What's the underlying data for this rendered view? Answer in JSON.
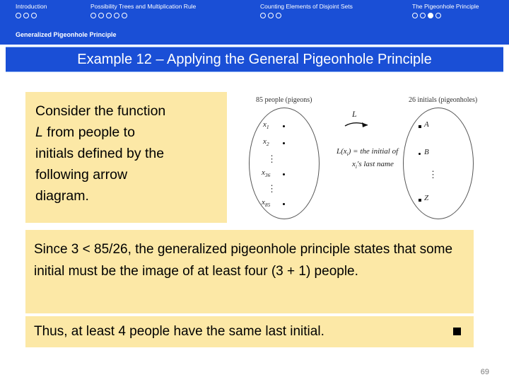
{
  "nav": {
    "sections": [
      {
        "label": "Introduction",
        "dots_total": 3,
        "dots_filled": 0
      },
      {
        "label": "Possibility Trees and Multiplication Rule",
        "dots_total": 5,
        "dots_filled": 0
      },
      {
        "label": "Counting Elements of Disjoint Sets",
        "dots_total": 3,
        "dots_filled": 0
      },
      {
        "label": "The Pigeonhole Principle",
        "dots_total": 4,
        "dots_filled": 1
      }
    ],
    "subsection": "Generalized Pigeonhole Principle",
    "accent_color": "#1a4fd6",
    "text_color": "#ffffff"
  },
  "title": "Example 12 – Applying the General Pigeonhole Principle",
  "boxes": {
    "intro": {
      "line1": "Consider the function",
      "line2_italic": "L",
      "line2_rest": " from people to",
      "line3": "initials defined by the",
      "line4": "following arrow",
      "line5": "diagram."
    },
    "since": "Since 3 < 85/26, the generalized pigeonhole principle states that some initial must be the image of at least four (3 + 1) people.",
    "thus": "Thus, at least 4 people have the same last initial."
  },
  "figure": {
    "left_caption": "85 people (pigeons)",
    "right_caption": "26 initials (pigeonholes)",
    "arrow_label": "L",
    "definition_line1": "L(x",
    "definition_line1_sub": "i",
    "definition_line1_rest": ") = the initial of",
    "definition_line2": "x",
    "definition_line2_sub": "i",
    "definition_line2_rest": "'s last name",
    "domain_elements": [
      "x1",
      "x2",
      "x36",
      "x85"
    ],
    "domain_labels": [
      {
        "base": "x",
        "sub": "1"
      },
      {
        "base": "x",
        "sub": "2"
      },
      {
        "base": "x",
        "sub": "36"
      },
      {
        "base": "x",
        "sub": "85"
      }
    ],
    "codomain_labels": [
      "A",
      "B",
      "Z"
    ],
    "ellipsis": "⋮"
  },
  "page_number": "69",
  "colors": {
    "box_fill": "#fce8a6",
    "nav_blue": "#1a4fd6",
    "page_number_gray": "#7a7a7a"
  }
}
